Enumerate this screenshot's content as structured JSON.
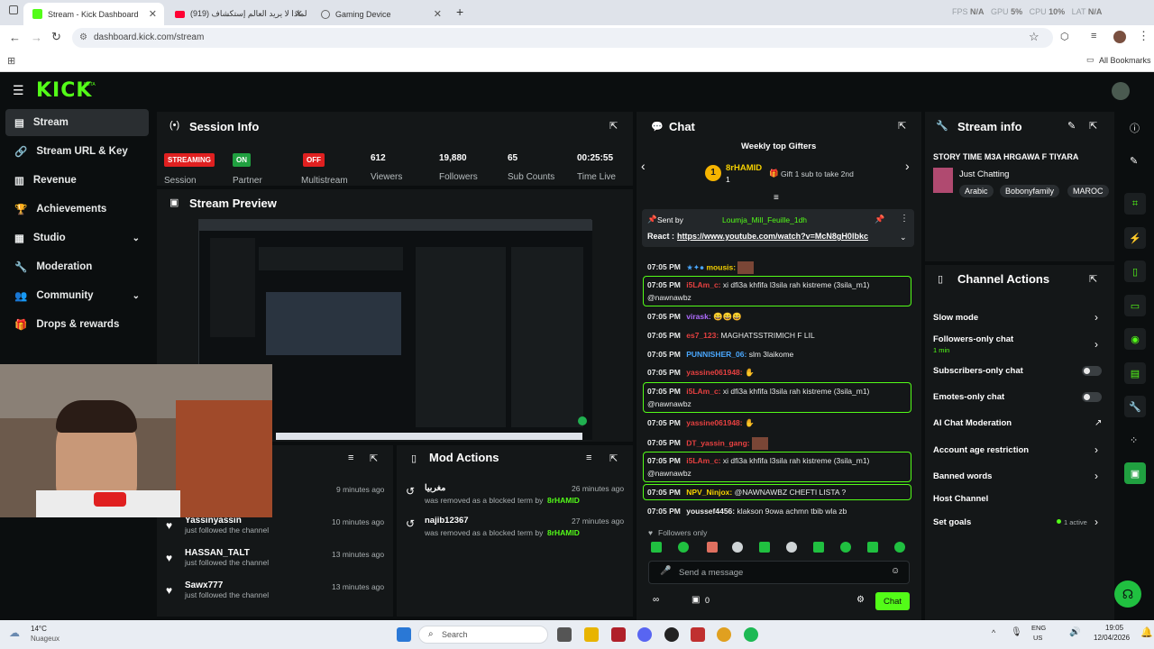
{
  "browser": {
    "tabs": [
      {
        "label": "Stream - Kick Dashboard"
      },
      {
        "label": "(919) لماذا لا يريد العالم إستكشاف"
      },
      {
        "label": "Gaming Device"
      }
    ],
    "url": "dashboard.kick.com/stream",
    "bookmarks_label": "All Bookmarks",
    "perf": {
      "fps_label": "FPS",
      "fps_value": "N/A",
      "gpu_label": "GPU",
      "gpu_value": "5%",
      "cpu_label": "CPU",
      "cpu_value": "10%",
      "lat_label": "LAT",
      "lat_value": "N/A"
    }
  },
  "app": {
    "logo": "KICK",
    "beta": "BETA"
  },
  "sidebar": {
    "items": [
      {
        "label": "Stream",
        "icon": "stream-icon"
      },
      {
        "label": "Stream URL & Key",
        "icon": "link-icon"
      },
      {
        "label": "Revenue",
        "icon": "chart-icon"
      },
      {
        "label": "Achievements",
        "icon": "trophy-icon"
      },
      {
        "label": "Studio",
        "icon": "studio-icon"
      },
      {
        "label": "Moderation",
        "icon": "wrench-icon"
      },
      {
        "label": "Community",
        "icon": "community-icon"
      },
      {
        "label": "Drops & rewards",
        "icon": "gift-icon"
      }
    ]
  },
  "session": {
    "title": "Session Info",
    "streaming_badge": "STREAMING",
    "session_label": "Session",
    "partner_badge": "ON",
    "partner_label": "Partner",
    "multistream_badge": "OFF",
    "multistream_label": "Multistream",
    "viewers": "612",
    "viewers_label": "Viewers",
    "followers": "19,880",
    "followers_label": "Followers",
    "subs": "65",
    "subs_label": "Sub Counts",
    "time_live": "00:25:55",
    "time_label": "Time Live"
  },
  "preview": {
    "title": "Stream Preview"
  },
  "followers_panel": {
    "rows": [
      {
        "name": "",
        "sub": "",
        "time": "9 minutes ago"
      },
      {
        "name": "Yassinyassin",
        "sub": "just followed the channel",
        "time": "10 minutes ago"
      },
      {
        "name": "HASSAN_TALT",
        "sub": "just followed the channel",
        "time": "13 minutes ago"
      },
      {
        "name": "Sawx777",
        "sub": "just followed the channel",
        "time": "13 minutes ago"
      }
    ]
  },
  "mod_actions": {
    "title": "Mod Actions",
    "rows": [
      {
        "user": "مغربيا",
        "text": "was removed as a blocked term by",
        "by": "8rHAMID",
        "time": "26 minutes ago"
      },
      {
        "user": "najib12367",
        "text": "was removed as a blocked term by",
        "by": "8rHAMID",
        "time": "27 minutes ago"
      }
    ]
  },
  "chat": {
    "title": "Chat",
    "gifters_title": "Weekly top Gifters",
    "top_gifter": "8rHAMID",
    "top_gifter_rank": "1",
    "gifter_sub": "1",
    "second_text": "Gift 1 sub to take 2nd",
    "pinned_by_label": "Sent by",
    "pinned_by": "Loumja_Mill_Feuille_1dh",
    "pinned_text_label": "React :",
    "pinned_link": "https://www.youtube.com/watch?v=McN8gH0lbkc",
    "messages": [
      {
        "time": "07:05 PM",
        "user": "mousis:",
        "text": "",
        "color": "#f5d000"
      },
      {
        "time": "07:05 PM",
        "user": "i5LAm_c:",
        "text": "xi dfi3a khfifa l3sila rah kistreme (3sila_m1)",
        "line2": "@nawnawbz",
        "color": "#e64040"
      },
      {
        "time": "07:05 PM",
        "user": "virask:",
        "text": "😄😄😄",
        "color": "#b06cff"
      },
      {
        "time": "07:05 PM",
        "user": "es7_123:",
        "text": "MAGHATSSTRIMICH F LIL",
        "color": "#e64040"
      },
      {
        "time": "07:05 PM",
        "user": "PUNNISHER_06:",
        "text": "slm 3laikome",
        "color": "#4aa8ff"
      },
      {
        "time": "07:05 PM",
        "user": "yassine061948:",
        "text": "",
        "color": "#e64040"
      },
      {
        "time": "07:05 PM",
        "user": "i5LAm_c:",
        "text": "xi dfi3a khfifa l3sila rah kistreme (3sila_m1)",
        "line2": "@nawnawbz",
        "color": "#e64040"
      },
      {
        "time": "07:05 PM",
        "user": "yassine061948:",
        "text": "",
        "color": "#e64040"
      },
      {
        "time": "07:05 PM",
        "user": "DT_yassin_gang:",
        "text": "",
        "color": "#e64040"
      },
      {
        "time": "07:05 PM",
        "user": "i5LAm_c:",
        "text": "xi dfi3a khfifa l3sila rah kistreme (3sila_m1)",
        "line2": "@nawnawbz",
        "color": "#e64040"
      },
      {
        "time": "07:05 PM",
        "user": "NPV_Ninjox:",
        "text": "@NAWNAWBZ CHEFTI LISTA ?",
        "color": "#f5d000"
      },
      {
        "time": "07:05 PM",
        "user": "youssef4456:",
        "text": "klakson 9owa achmn tbib wla zb",
        "color": "#f0f0f0"
      }
    ],
    "followers_only": "Followers only",
    "input_placeholder": "Send a message",
    "points": "0",
    "send_label": "Chat"
  },
  "stream_info": {
    "title": "Stream info",
    "stream_title": "STORY TIME M3A HRGAWA F TIYARA",
    "category": "Just Chatting",
    "tags": [
      "Arabic",
      "Bobonyfamily",
      "MAROC"
    ]
  },
  "channel_actions": {
    "title": "Channel Actions",
    "items": [
      {
        "label": "Slow mode"
      },
      {
        "label": "Followers-only chat",
        "sub": "1 min"
      },
      {
        "label": "Subscribers-only chat"
      },
      {
        "label": "Emotes-only chat"
      },
      {
        "label": "AI Chat Moderation"
      },
      {
        "label": "Account age restriction"
      },
      {
        "label": "Banned words"
      },
      {
        "label": "Host Channel"
      },
      {
        "label": "Set goals",
        "sub": "1 active"
      }
    ]
  },
  "taskbar": {
    "weather_temp": "14°C",
    "weather_desc": "Nuageux",
    "search": "Search",
    "lang": "ENG",
    "lang2": "US",
    "time": "19:05",
    "date": "12/04/2026"
  }
}
